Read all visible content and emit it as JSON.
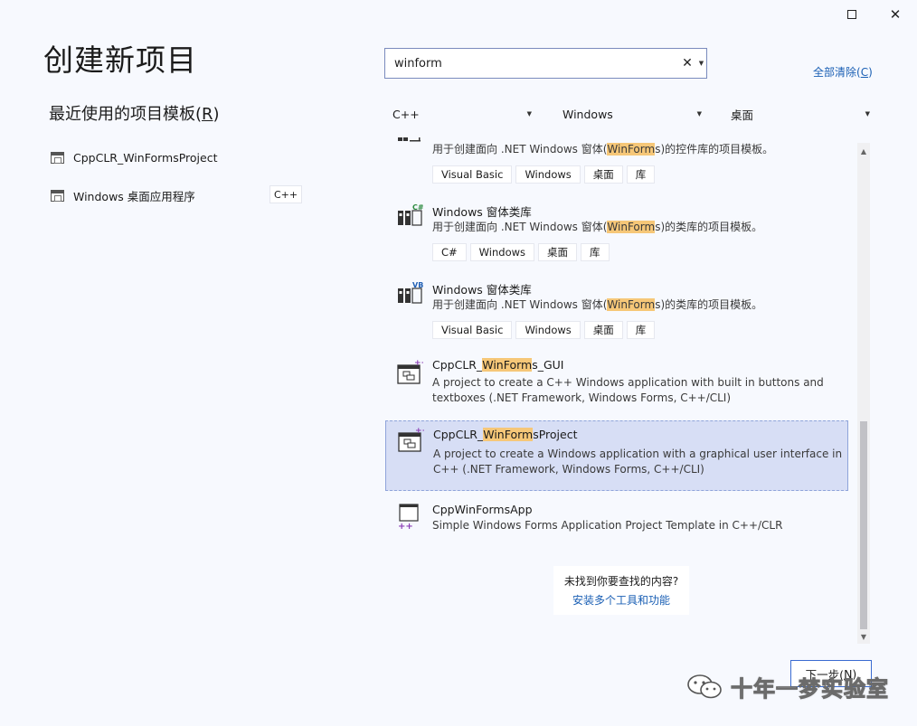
{
  "window": {
    "maximize_icon": "maximize-icon",
    "close_glyph": "✕"
  },
  "page_title": "创建新项目",
  "recent": {
    "title_prefix": "最近使用的项目模板(",
    "title_key": "R",
    "title_suffix": ")",
    "items": [
      {
        "label": "CppCLR_WinFormsProject",
        "tag": ""
      },
      {
        "label": "Windows 桌面应用程序",
        "tag": "C++"
      }
    ]
  },
  "search": {
    "value": "winform",
    "clear_glyph": "✕",
    "drop_glyph": "▼"
  },
  "clear_all": {
    "prefix": "全部清除(",
    "key": "C",
    "suffix": ")"
  },
  "filters": {
    "language": "C++",
    "platform": "Windows",
    "type": "桌面",
    "arrow": "▼"
  },
  "templates": [
    {
      "name": "",
      "desc_before": "用于创建面向 .NET Windows 窗体(",
      "desc_hl": "WinForm",
      "desc_after": "s)的控件库的项目模板。",
      "tags": [
        "Visual Basic",
        "Windows",
        "桌面",
        "库"
      ]
    },
    {
      "name": "Windows 窗体类库",
      "badge": "C#",
      "desc_before": "用于创建面向 .NET Windows 窗体(",
      "desc_hl": "WinForm",
      "desc_after": "s)的类库的项目模板。",
      "tags": [
        "C#",
        "Windows",
        "桌面",
        "库"
      ]
    },
    {
      "name": "Windows 窗体类库",
      "badge": "VB",
      "desc_before": "用于创建面向 .NET Windows 窗体(",
      "desc_hl": "WinForm",
      "desc_after": "s)的类库的项目模板。",
      "tags": [
        "Visual Basic",
        "Windows",
        "桌面",
        "库"
      ]
    },
    {
      "name_before": "CppCLR_",
      "name_hl": "WinForm",
      "name_after": "s_GUI",
      "desc": "A project to create a C++ Windows application with built in buttons and textboxes (.NET Framework, Windows Forms, C++/CLI)"
    },
    {
      "name_before": "CppCLR_",
      "name_hl": "WinForm",
      "name_after": "sProject",
      "desc": "A project to create a Windows application with a graphical user interface in C++ (.NET Framework, Windows Forms, C++/CLI)"
    },
    {
      "name": "CppWinFormsApp",
      "desc": "Simple Windows Forms Application Project Template in C++/CLR"
    }
  ],
  "not_found": {
    "question": "未找到你要查找的内容?",
    "link": "安装多个工具和功能"
  },
  "next_button": {
    "prefix": "下一步(",
    "key": "N",
    "suffix": ")"
  },
  "watermark": "十年一梦实验室",
  "colors": {
    "background": "#f7f9fe",
    "highlight": "#f6c778",
    "selected_bg": "#d7def5",
    "link": "#1a5fb4",
    "accent_border": "#3a6bd1"
  }
}
